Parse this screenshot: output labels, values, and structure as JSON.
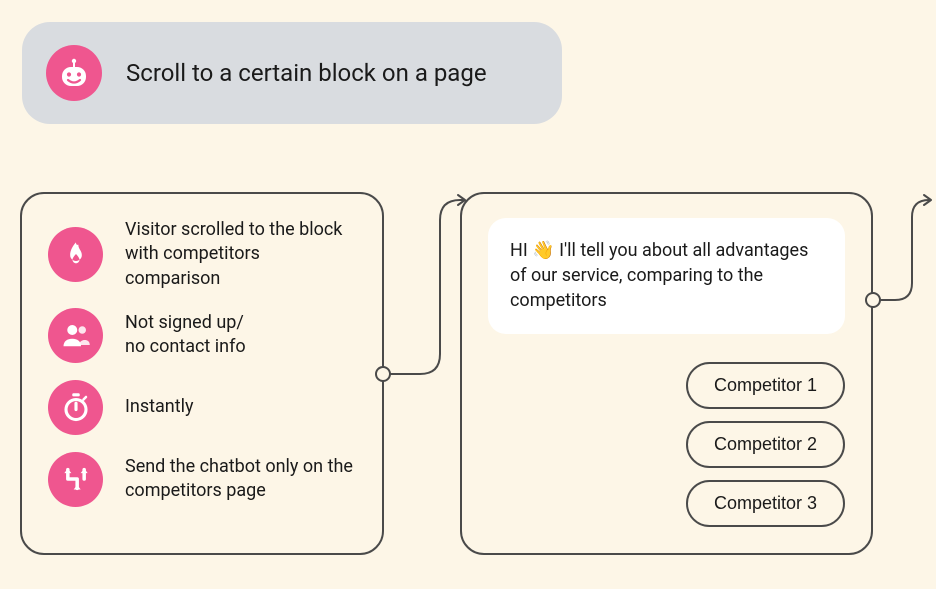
{
  "header": {
    "title": "Scroll to a certain block on a page",
    "icon": "bot-icon"
  },
  "triggers": [
    {
      "icon": "fire-icon",
      "text": "Visitor scrolled to the block with competitors comparison"
    },
    {
      "icon": "users-icon",
      "text": "Not signed up/\nno contact info"
    },
    {
      "icon": "stopwatch-icon",
      "text": "Instantly"
    },
    {
      "icon": "route-icon",
      "text": "Send the chatbot only on the competitors page"
    }
  ],
  "chat": {
    "message_pre": "HI ",
    "message_post": " I'll tell you about all advantages of our service, comparing to the competitors",
    "wave": "👋",
    "options": [
      "Competitor 1",
      "Competitor 2",
      "Competitor 3"
    ]
  }
}
